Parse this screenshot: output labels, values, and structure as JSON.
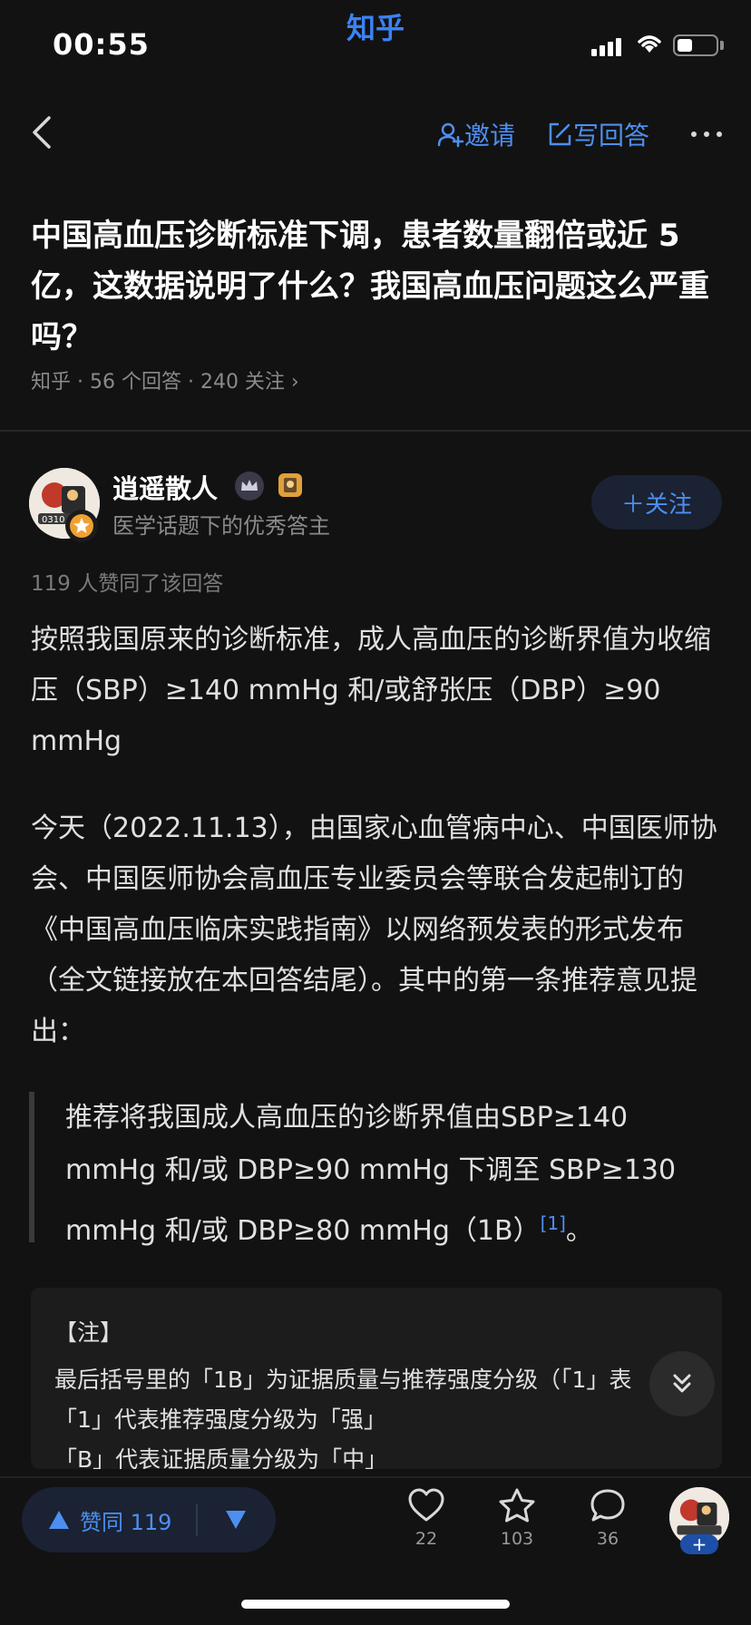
{
  "status_bar": {
    "time": "00:55",
    "app_tag": "知乎"
  },
  "nav": {
    "invite_label": "邀请",
    "write_label": "写回答"
  },
  "question": {
    "title": "中国高血压诊断标准下调，患者数量翻倍或近 5 亿，这数据说明了什么？我国高血压问题这么严重吗？",
    "meta": "知乎 · 56 个回答 · 240 关注 ›"
  },
  "author": {
    "name": "逍遥散人",
    "description": "医学话题下的优秀答主",
    "follow_label": "＋关注"
  },
  "answer": {
    "likes_line": "119 人赞同了该回答",
    "paragraph1": "按照我国原来的诊断标准，成人高血压的诊断界值为收缩压（SBP）≥140 mmHg 和/或舒张压（DBP）≥90 mmHg",
    "paragraph2": "今天（2022.11.13），由国家心血管病中心、中国医师协会、中国医师协会高血压专业委员会等联合发起制订的《中国高血压临床实践指南》以网络预发表的形式发布（全文链接放在本回答结尾）。其中的第一条推荐意见提出：",
    "quote": "推荐将我国成人高血压的诊断界值由SBP≥140 mmHg 和/或 DBP≥90 mmHg 下调至 SBP≥130 mmHg 和/或 DBP≥80 mmHg（1B）",
    "quote_ref": "[1]",
    "quote_end": "。",
    "note": {
      "title": "【注】",
      "line1": "最后括号里的「1B」为证据质量与推荐强度分级（「1」表",
      "line2": "「1」代表推荐强度分级为「强」",
      "line3": "「B」代表证据质量分级为「中」"
    }
  },
  "bottom_bar": {
    "vote_label": "赞同 119",
    "like_count": "22",
    "favorite_count": "103",
    "comment_count": "36",
    "add_label": "+"
  },
  "colors": {
    "accent": "#4d8ff0",
    "background": "#121212"
  }
}
